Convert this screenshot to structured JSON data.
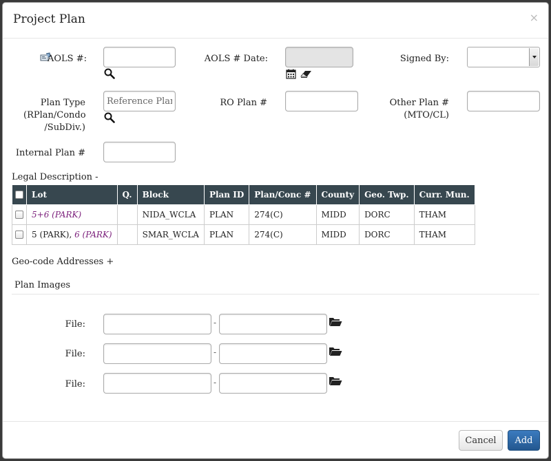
{
  "modal": {
    "title": "Project Plan",
    "close_glyph": "×"
  },
  "fields": {
    "aols_label": "AOLS #:",
    "aols_value": "",
    "aols_date_label": "AOLS # Date:",
    "aols_date_value": "",
    "signed_by_label": "Signed By:",
    "signed_by_value": "",
    "plan_type_label_1": "Plan Type",
    "plan_type_label_2": "(RPlan/Condo",
    "plan_type_label_3": "/SubDiv.)",
    "plan_type_placeholder": "Reference Plan",
    "ro_plan_label": "RO Plan #",
    "ro_plan_value": "",
    "other_plan_label_1": "Other Plan #",
    "other_plan_label_2": "(MTO/CL)",
    "other_plan_value": "",
    "internal_plan_label": "Internal Plan #",
    "internal_plan_value": ""
  },
  "legal": {
    "heading": "Legal Description -",
    "columns": [
      "Lot",
      "Q.",
      "Block",
      "Plan ID",
      "Plan/Conc #",
      "County",
      "Geo. Twp.",
      "Curr. Mun."
    ],
    "rows": [
      {
        "lot_plain": "",
        "lot_link": "5+6 (PARK)",
        "q": "",
        "block": "NIDA_WCLA",
        "plan_id": "PLAN",
        "plan_conc": "274(C)",
        "county": "MIDD",
        "geo_twp": "DORC",
        "curr_mun": "THAM"
      },
      {
        "lot_plain": "5 (PARK), ",
        "lot_link": "6 (PARK)",
        "q": "",
        "block": "SMAR_WCLA",
        "plan_id": "PLAN",
        "plan_conc": "274(C)",
        "county": "MIDD",
        "geo_twp": "DORC",
        "curr_mun": "THAM"
      }
    ]
  },
  "geocode": {
    "heading": "Geo-code Addresses +"
  },
  "images": {
    "heading": "Plan Images",
    "file_label": "File:",
    "separator": "-"
  },
  "footer": {
    "cancel_label": "Cancel",
    "add_label": "Add"
  },
  "icons": {
    "aols": "id-card-icon",
    "search": "magnifier-icon",
    "calendar": "calendar-icon",
    "eraser": "eraser-icon",
    "folder": "folder-open-icon"
  },
  "colors": {
    "table_header": "#37474f",
    "link": "#7b1f7b",
    "primary_button": "#2a65a5"
  }
}
